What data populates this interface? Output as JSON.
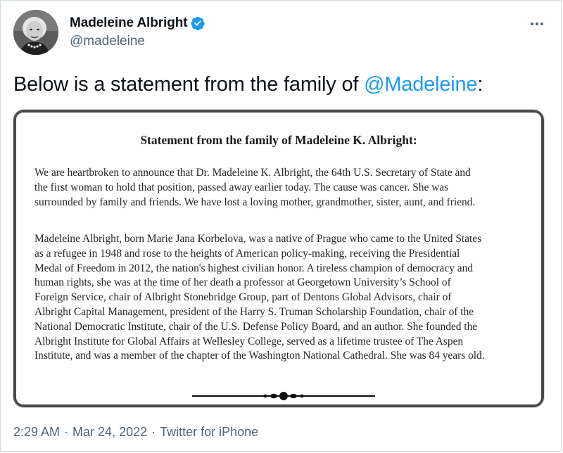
{
  "author": {
    "display_name": "Madeleine Albright",
    "handle": "@madeleine",
    "verified": true,
    "avatar_icon": "profile-photo"
  },
  "tweet": {
    "text_before": "Below is a statement from the family of ",
    "mention": "@Madeleine",
    "text_after": ":"
  },
  "statement": {
    "title": "Statement from the family of Madeleine K. Albright:",
    "paragraph1": [
      "We are heartbroken to announce that Dr. Madeleine K. Albright, the 64th U.S. Secretary of State and",
      "the first woman to hold that position, passed away earlier today. The cause was cancer. She was",
      "surrounded by family and friends. We have lost a loving mother, grandmother, sister, aunt, and friend."
    ],
    "paragraph2": [
      "Madeleine Albright, born Marie Jana Korbelova, was a native of Prague who came to the United States",
      "as a refugee in 1948 and rose to the heights of American policy-making, receiving the Presidential",
      "Medal of Freedom in 2012, the nation's highest civilian honor. A tireless champion of democracy and",
      "human rights, she was at the time of her death a professor at Georgetown University’s School of",
      "Foreign Service, chair of Albright Stonebridge Group, part of Dentons Global Advisors, chair of",
      "Albright Capital Management, president of the Harry S. Truman Scholarship Foundation, chair of the",
      "National Democratic Institute, chair of the U.S. Defense Policy Board, and an author. She founded the",
      "Albright Institute for Global Affairs at Wellesley College, served as a lifetime trustee of The Aspen",
      "Institute, and was a member of the chapter of the Washington National Cathedral. She was 84 years old."
    ]
  },
  "meta": {
    "time": "2:29 AM",
    "separator": "·",
    "date": "Mar 24, 2022",
    "source": "Twitter for iPhone"
  },
  "colors": {
    "accent": "#1d9bf0",
    "text_primary": "#0f1419",
    "text_secondary": "#536471"
  }
}
